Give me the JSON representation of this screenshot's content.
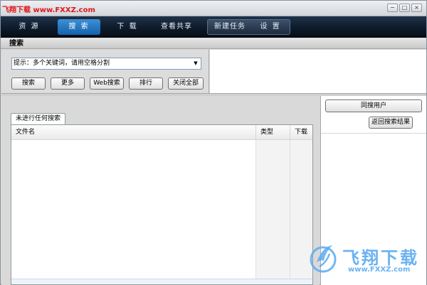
{
  "window": {
    "title": "飞翔下载 www.FXXZ.com",
    "controls": {
      "minimize": "−",
      "maximize": "□",
      "close": "×"
    }
  },
  "nav": {
    "tabs": [
      {
        "label": "资 源",
        "active": false
      },
      {
        "label": "搜 索",
        "active": true
      },
      {
        "label": "下 载",
        "active": false
      },
      {
        "label": "查看共享",
        "active": false
      }
    ],
    "actions": [
      {
        "label": "新建任务"
      },
      {
        "label": "设 置"
      }
    ]
  },
  "search": {
    "header": "搜索",
    "combo_value": "提示：多个关键词，请用空格分割",
    "combo_arrow": "▼",
    "buttons": {
      "search": "搜索",
      "more": "更多",
      "web_search": "Web搜索",
      "rank": "排行",
      "close_all": "关闭全部"
    }
  },
  "results": {
    "tab_label": "未进行任何搜索",
    "columns": {
      "filename": "文件名",
      "type": "类型",
      "download": "下载"
    }
  },
  "side": {
    "same_users_button": "同搜用户",
    "back_results_button": "返回搜索结果"
  },
  "watermark": {
    "title": "飞翔下载",
    "url": "www.FXXZ.com"
  },
  "colors": {
    "title_text": "#e0161b",
    "nav_active": "#1f78c8",
    "watermark": "#5aaaf0"
  }
}
